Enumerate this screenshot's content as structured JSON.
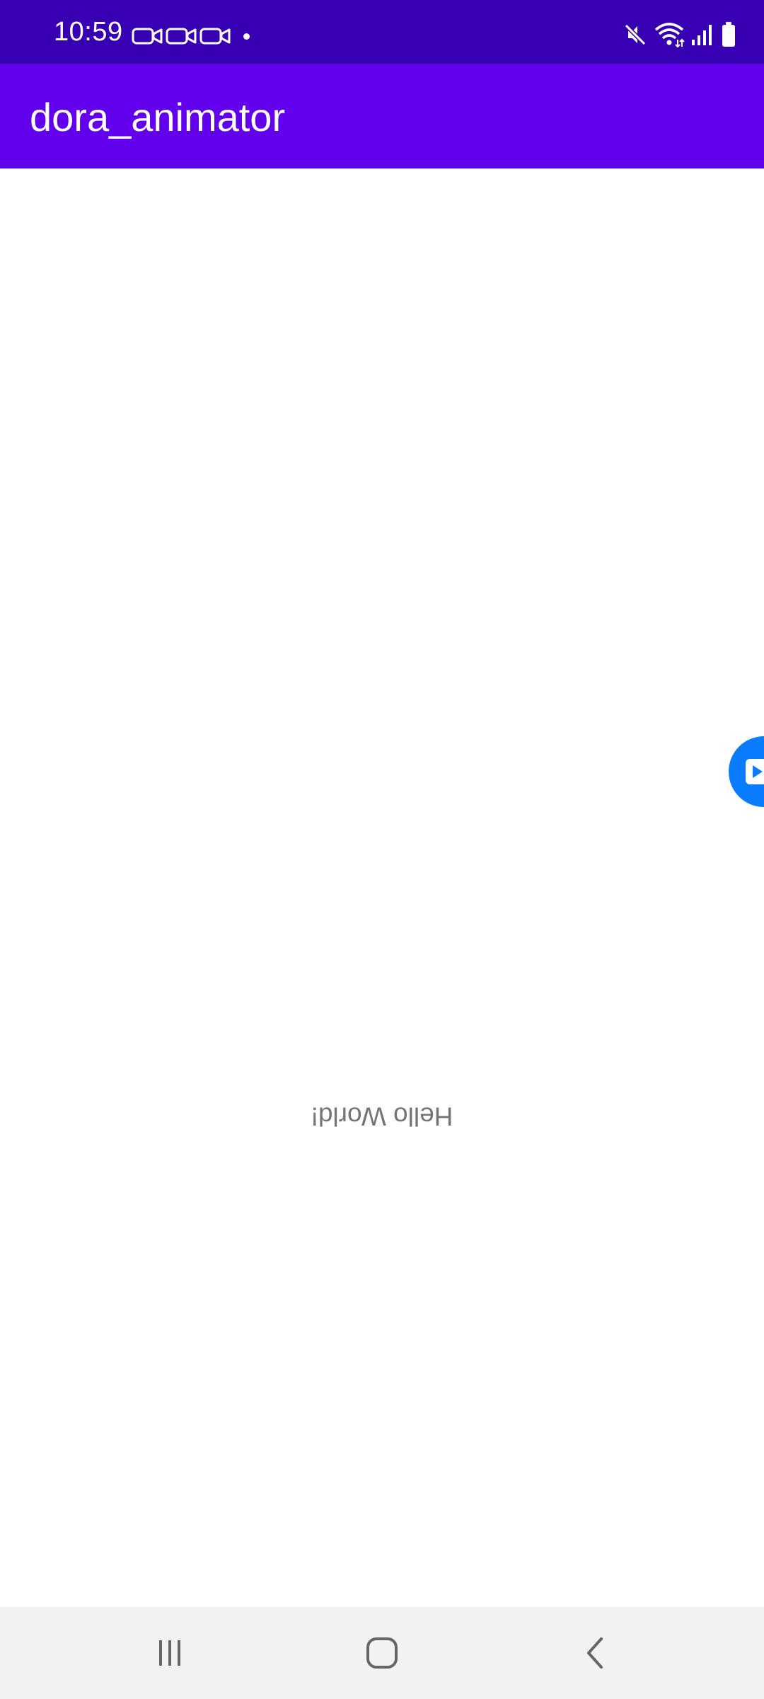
{
  "status_bar": {
    "time": "10:59",
    "left_icons": [
      "video-camera-icon",
      "video-camera-icon",
      "video-camera-icon",
      "notification-dot"
    ],
    "right_icons": [
      "mute-icon",
      "wifi-icon",
      "signal-icon",
      "battery-icon"
    ]
  },
  "app_bar": {
    "title": "dora_animator"
  },
  "content": {
    "hello_text": "Hello World!"
  },
  "navigation_bar": {
    "buttons": [
      "recent-apps-icon",
      "home-icon",
      "back-icon"
    ]
  },
  "colors": {
    "status_bar": "#3700b3",
    "app_bar": "#6200ee",
    "background": "#ffffff",
    "nav_bar": "#f2f2f2",
    "text_gray": "#757575",
    "floating_bubble": "#0a7cff"
  }
}
